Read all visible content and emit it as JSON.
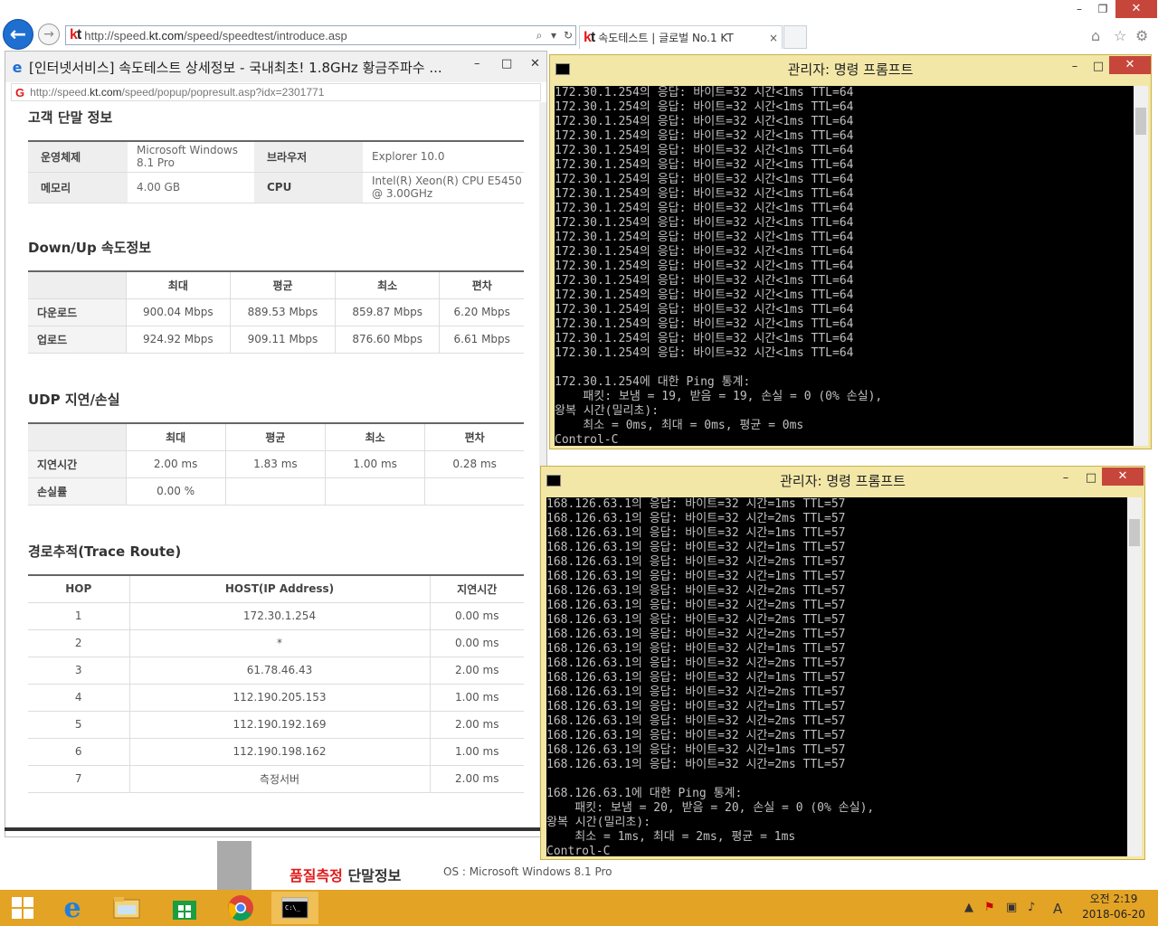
{
  "browser": {
    "address_url_prefix": "http://speed.",
    "address_url_domain": "kt.com",
    "address_url_path": "/speed/speedtest/introduce.asp",
    "tab_title": "속도테스트 | 글로벌 No.1 KT",
    "tab_close": "×"
  },
  "popup": {
    "title": "[인터넷서비스] 속도테스트 상세정보 - 국내최초! 1.8GHz 황금주파수 ...",
    "url_prefix": "http://speed.",
    "url_domain": "kt.com",
    "url_path": "/speed/popup/popresult.asp?idx=2301771",
    "client_section": {
      "title": "고객 단말 정보",
      "os_label": "운영체제",
      "os_value_1": "Microsoft Windows",
      "os_value_2": "8.1 Pro",
      "browser_label": "브라우저",
      "browser_value": "Explorer 10.0",
      "memory_label": "메모리",
      "memory_value": "4.00 GB",
      "cpu_label": "CPU",
      "cpu_value_1": "Intel(R) Xeon(R) CPU E5450",
      "cpu_value_2": "@ 3.00GHz"
    },
    "speed_section": {
      "title": "Down/Up 속도정보",
      "headers": [
        "최대",
        "평균",
        "최소",
        "편차"
      ],
      "rows": [
        {
          "label": "다운로드",
          "values": [
            "900.04 Mbps",
            "889.53 Mbps",
            "859.87 Mbps",
            "6.20 Mbps"
          ]
        },
        {
          "label": "업로드",
          "values": [
            "924.92 Mbps",
            "909.11 Mbps",
            "876.60 Mbps",
            "6.61 Mbps"
          ]
        }
      ]
    },
    "udp_section": {
      "title": "UDP 지연/손실",
      "headers": [
        "최대",
        "평균",
        "최소",
        "편차"
      ],
      "rows": [
        {
          "label": "지연시간",
          "values": [
            "2.00 ms",
            "1.83 ms",
            "1.00 ms",
            "0.28 ms"
          ]
        },
        {
          "label": "손실률",
          "values": [
            "0.00 %",
            "",
            "",
            ""
          ]
        }
      ]
    },
    "trace_section": {
      "title": "경로추적(Trace Route)",
      "headers": [
        "HOP",
        "HOST(IP Address)",
        "지연시간"
      ],
      "rows": [
        [
          "1",
          "172.30.1.254",
          "0.00 ms"
        ],
        [
          "2",
          "*",
          "0.00 ms"
        ],
        [
          "3",
          "61.78.46.43",
          "2.00 ms"
        ],
        [
          "4",
          "112.190.205.153",
          "1.00 ms"
        ],
        [
          "5",
          "112.190.192.169",
          "2.00 ms"
        ],
        [
          "6",
          "112.190.198.162",
          "1.00 ms"
        ],
        [
          "7",
          "측정서버",
          "2.00 ms"
        ]
      ]
    }
  },
  "background_page": {
    "quality_red": "품질측정",
    "quality_black": " 단말정보",
    "os_line": "OS : Microsoft Windows 8.1 Pro"
  },
  "cmd1": {
    "title": "관리자: 명령 프롬프트",
    "lines": [
      "172.30.1.254의 응답: 바이트=32 시간<1ms TTL=64",
      "172.30.1.254의 응답: 바이트=32 시간<1ms TTL=64",
      "172.30.1.254의 응답: 바이트=32 시간<1ms TTL=64",
      "172.30.1.254의 응답: 바이트=32 시간<1ms TTL=64",
      "172.30.1.254의 응답: 바이트=32 시간<1ms TTL=64",
      "172.30.1.254의 응답: 바이트=32 시간<1ms TTL=64",
      "172.30.1.254의 응답: 바이트=32 시간<1ms TTL=64",
      "172.30.1.254의 응답: 바이트=32 시간<1ms TTL=64",
      "172.30.1.254의 응답: 바이트=32 시간<1ms TTL=64",
      "172.30.1.254의 응답: 바이트=32 시간<1ms TTL=64",
      "172.30.1.254의 응답: 바이트=32 시간<1ms TTL=64",
      "172.30.1.254의 응답: 바이트=32 시간<1ms TTL=64",
      "172.30.1.254의 응답: 바이트=32 시간<1ms TTL=64",
      "172.30.1.254의 응답: 바이트=32 시간<1ms TTL=64",
      "172.30.1.254의 응답: 바이트=32 시간<1ms TTL=64",
      "172.30.1.254의 응답: 바이트=32 시간<1ms TTL=64",
      "172.30.1.254의 응답: 바이트=32 시간<1ms TTL=64",
      "172.30.1.254의 응답: 바이트=32 시간<1ms TTL=64",
      "172.30.1.254의 응답: 바이트=32 시간<1ms TTL=64",
      "",
      "172.30.1.254에 대한 Ping 통계:",
      "    패킷: 보냄 = 19, 받음 = 19, 손실 = 0 (0% 손실),",
      "왕복 시간(밀리초):",
      "    최소 = 0ms, 최대 = 0ms, 평균 = 0ms",
      "Control-C"
    ]
  },
  "cmd2": {
    "title": "관리자: 명령 프롬프트",
    "lines": [
      "168.126.63.1의 응답: 바이트=32 시간=1ms TTL=57",
      "168.126.63.1의 응답: 바이트=32 시간=2ms TTL=57",
      "168.126.63.1의 응답: 바이트=32 시간=1ms TTL=57",
      "168.126.63.1의 응답: 바이트=32 시간=1ms TTL=57",
      "168.126.63.1의 응답: 바이트=32 시간=2ms TTL=57",
      "168.126.63.1의 응답: 바이트=32 시간=1ms TTL=57",
      "168.126.63.1의 응답: 바이트=32 시간=2ms TTL=57",
      "168.126.63.1의 응답: 바이트=32 시간=2ms TTL=57",
      "168.126.63.1의 응답: 바이트=32 시간=2ms TTL=57",
      "168.126.63.1의 응답: 바이트=32 시간=2ms TTL=57",
      "168.126.63.1의 응답: 바이트=32 시간=1ms TTL=57",
      "168.126.63.1의 응답: 바이트=32 시간=2ms TTL=57",
      "168.126.63.1의 응답: 바이트=32 시간=1ms TTL=57",
      "168.126.63.1의 응답: 바이트=32 시간=2ms TTL=57",
      "168.126.63.1의 응답: 바이트=32 시간=1ms TTL=57",
      "168.126.63.1의 응답: 바이트=32 시간=2ms TTL=57",
      "168.126.63.1의 응답: 바이트=32 시간=2ms TTL=57",
      "168.126.63.1의 응답: 바이트=32 시간=1ms TTL=57",
      "168.126.63.1의 응답: 바이트=32 시간=2ms TTL=57",
      "",
      "168.126.63.1에 대한 Ping 통계:",
      "    패킷: 보냄 = 20, 받음 = 20, 손실 = 0 (0% 손실),",
      "왕복 시간(밀리초):",
      "    최소 = 1ms, 최대 = 2ms, 평균 = 1ms",
      "Control-C"
    ]
  },
  "taskbar": {
    "time": "오전 2:19",
    "date": "2018-06-20",
    "ime": "A"
  },
  "colors": {
    "taskbar": "#e3a325",
    "cmd_titlebar": "#f3e7a7",
    "close_button": "#c7463b",
    "kt_red": "#e21a1a"
  }
}
